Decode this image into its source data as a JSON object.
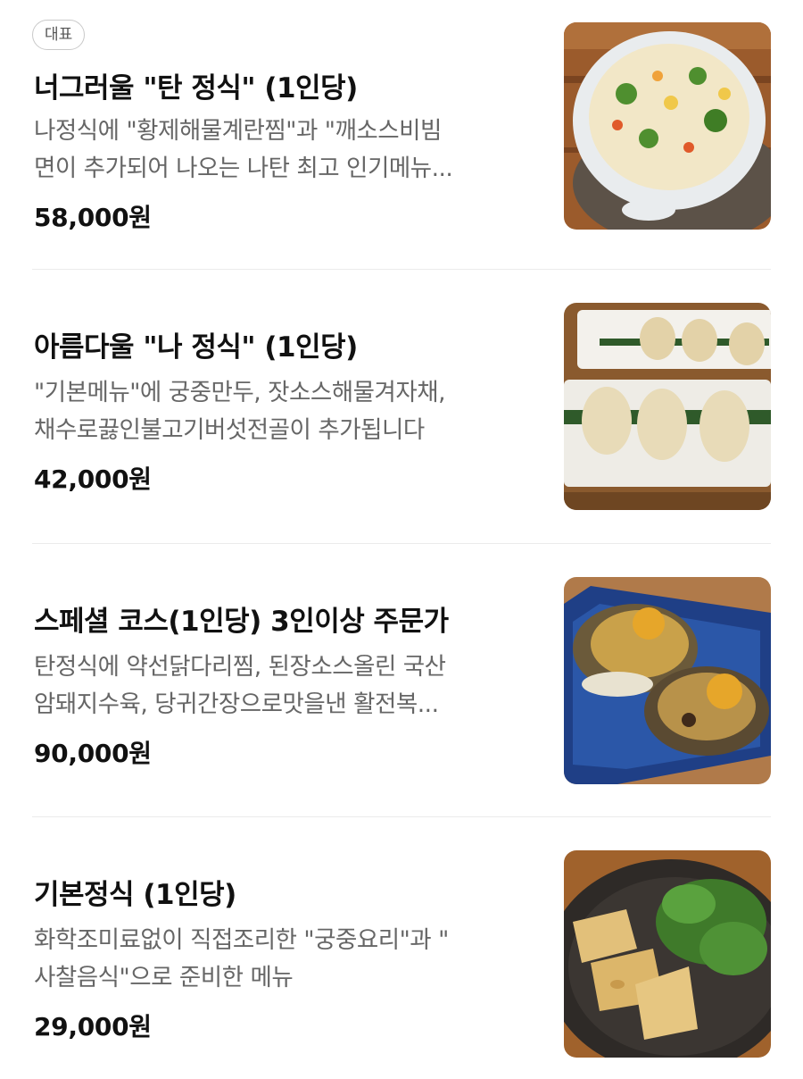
{
  "menu": {
    "items": [
      {
        "badge": "대표",
        "title": "너그러울 \"탄 정식\" (1인당)",
        "desc_lines": [
          "나정식에 \"황제해물계란찜\"과 \"깨소스비빔",
          "면이 추가되어 나오는 나탄 최고 인기메뉴..."
        ],
        "price": "58,000원",
        "image": "seafood-egg-stew-photo"
      },
      {
        "title": "아름다울 \"나 정식\" (1인당)",
        "desc_lines": [
          "\"기본메뉴\"에 궁중만두, 잣소스해물겨자채,",
          "채수로끓인불고기버섯전골이 추가됩니다"
        ],
        "price": "42,000원",
        "image": "dumplings-photo"
      },
      {
        "title": "스페셜 코스(1인당) 3인이상 주문가",
        "desc_lines": [
          "탄정식에 약선닭다리찜, 된장소스올린 국산",
          "암돼지수육, 당귀간장으로맛을낸 활전복..."
        ],
        "price": "90,000원",
        "image": "abalone-photo"
      },
      {
        "title": "기본정식 (1인당)",
        "desc_lines": [
          "화학조미료없이 직접조리한 \"궁중요리\"과 \"",
          "사찰음식\"으로 준비한 메뉴"
        ],
        "price": "29,000원",
        "image": "fried-tofu-salad-photo"
      }
    ]
  }
}
